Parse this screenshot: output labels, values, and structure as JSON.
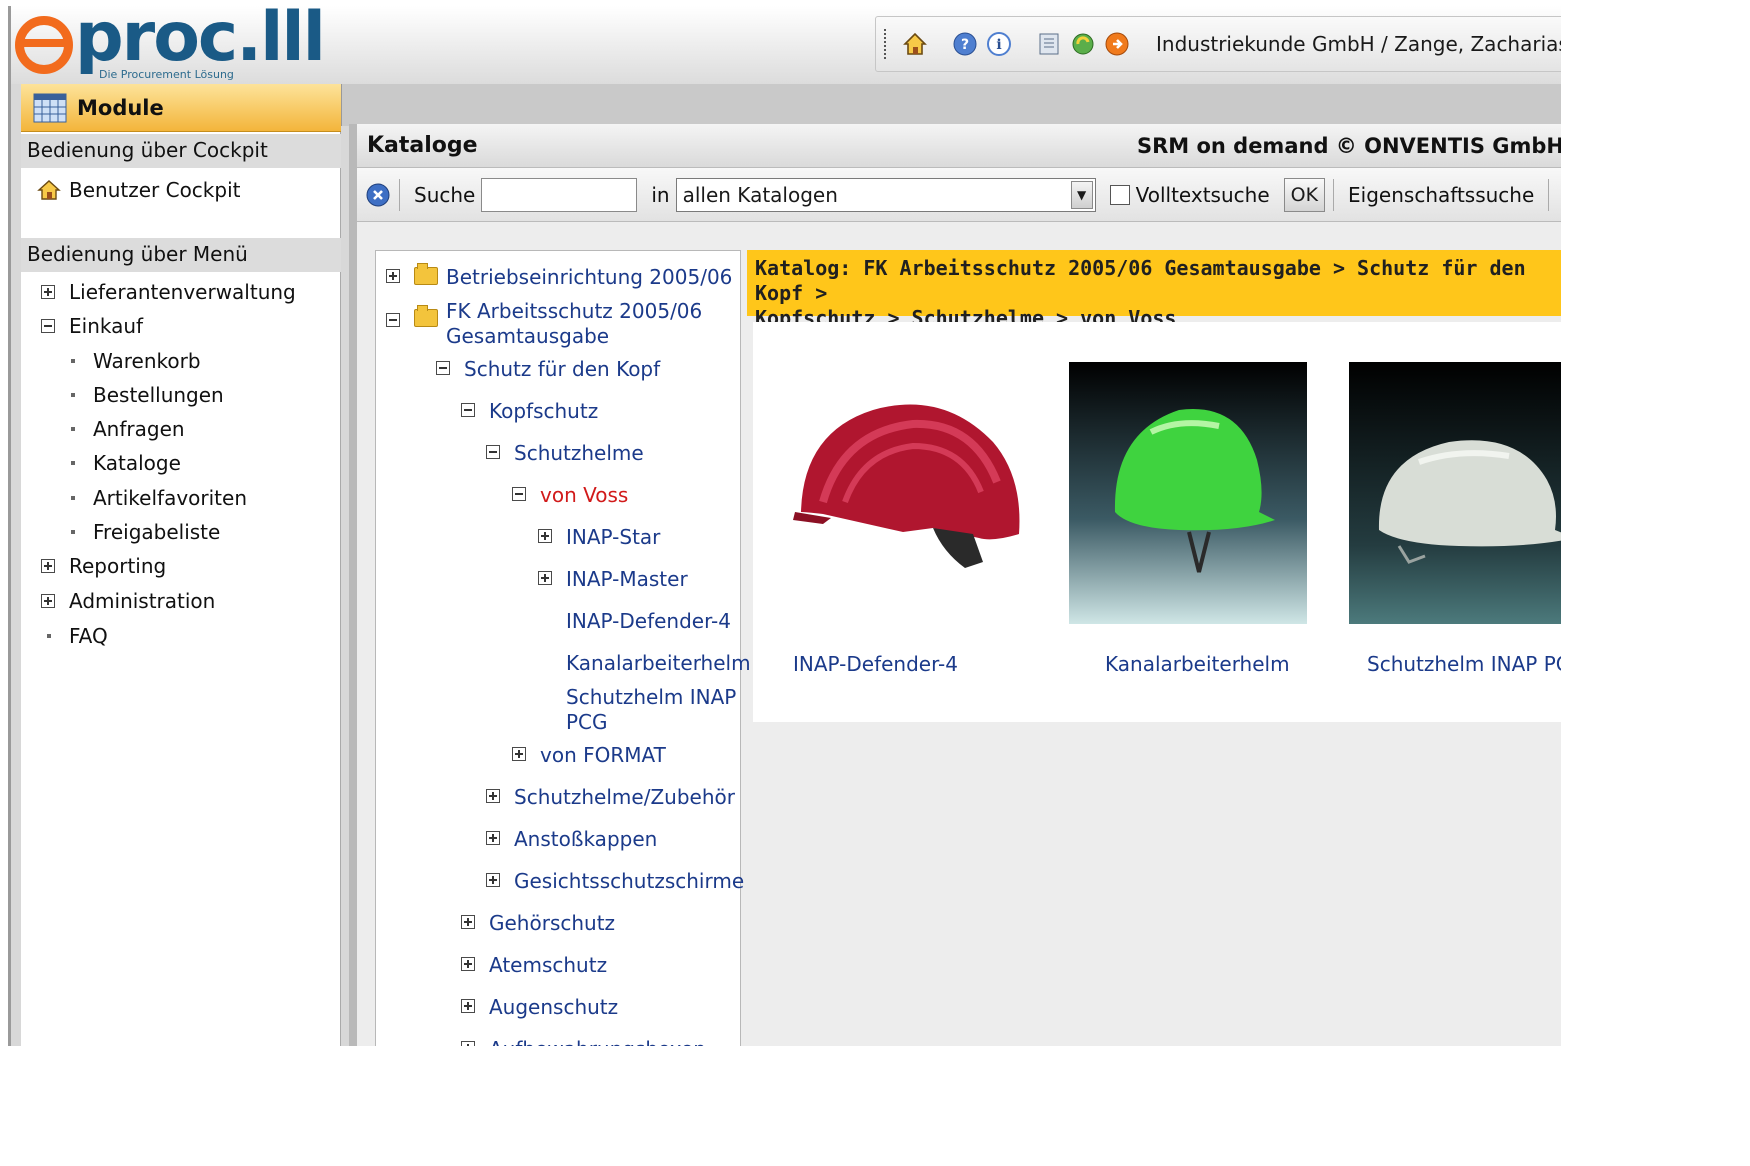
{
  "app": {
    "logo_word": "proc.lll",
    "logo_tagline": "Die Procurement Lösung",
    "user_label": "Industriekunde GmbH / Zange, Zacharias"
  },
  "toolbar_icons": [
    "home-icon",
    "help-icon",
    "info-icon",
    "notes-icon",
    "refresh-icon",
    "logout-icon"
  ],
  "sidebar": {
    "module_label": "Module",
    "cockpit_header": "Bedienung über Cockpit",
    "cockpit_item": "Benutzer Cockpit",
    "menu_header": "Bedienung über Menü",
    "items": [
      {
        "label": "Lieferantenverwaltung",
        "state": "plus"
      },
      {
        "label": "Einkauf",
        "state": "minus"
      },
      {
        "label": "Warenkorb",
        "state": "bullet"
      },
      {
        "label": "Bestellungen",
        "state": "bullet"
      },
      {
        "label": "Anfragen",
        "state": "bullet"
      },
      {
        "label": "Kataloge",
        "state": "bullet"
      },
      {
        "label": "Artikelfavoriten",
        "state": "bullet"
      },
      {
        "label": "Freigabeliste",
        "state": "bullet"
      },
      {
        "label": "Reporting",
        "state": "plus"
      },
      {
        "label": "Administration",
        "state": "plus"
      },
      {
        "label": "FAQ",
        "state": "bullet"
      }
    ]
  },
  "main": {
    "title": "Kataloge",
    "copyright": "SRM on demand © ONVENTIS GmbH",
    "search": {
      "label": "Suche",
      "value": "",
      "in_label": "in",
      "catalog_selected": "allen Katalogen",
      "fulltext_label": "Volltextsuche",
      "ok_label": "OK",
      "property_search_label": "Eigenschaftssuche"
    },
    "tree": [
      {
        "label": "Betriebseinrichtung 2005/06"
      },
      {
        "label": "FK Arbeitsschutz 2005/06",
        "label2": "Gesamtausgabe"
      },
      {
        "label": "Schutz für den Kopf"
      },
      {
        "label": "Kopfschutz"
      },
      {
        "label": "Schutzhelme"
      },
      {
        "label": "von Voss"
      },
      {
        "label": "INAP-Star"
      },
      {
        "label": "INAP-Master"
      },
      {
        "label": "INAP-Defender-4"
      },
      {
        "label": "Kanalarbeiterhelm"
      },
      {
        "label": "Schutzhelm INAP",
        "label2": "PCG"
      },
      {
        "label": "von FORMAT"
      },
      {
        "label": "Schutzhelme/Zubehör"
      },
      {
        "label": "Anstoßkappen"
      },
      {
        "label": "Gesichtsschutzschirme"
      },
      {
        "label": "Gehörschutz"
      },
      {
        "label": "Atemschutz"
      },
      {
        "label": "Augenschutz"
      },
      {
        "label": "Aufbewahrungsboxen"
      }
    ],
    "breadcrumb_line1": "Katalog: FK Arbeitsschutz 2005/06 Gesamtausgabe > Schutz für den Kopf >",
    "breadcrumb_line2": "Kopfschutz > Schutzhelme > von Voss",
    "products": [
      {
        "name": "INAP-Defender-4",
        "color": "#b0162f"
      },
      {
        "name": "Kanalarbeiterhelm",
        "color": "#3fd33f"
      },
      {
        "name": "Schutzhelm INAP PCG",
        "color": "#d8ddd6"
      }
    ]
  },
  "colors": {
    "accent_orange": "#f26b1d",
    "logo_blue": "#1a5a86",
    "breadcrumb_bg": "#ffc61a",
    "link_blue": "#1b3a8a",
    "active_red": "#d11a1a"
  }
}
